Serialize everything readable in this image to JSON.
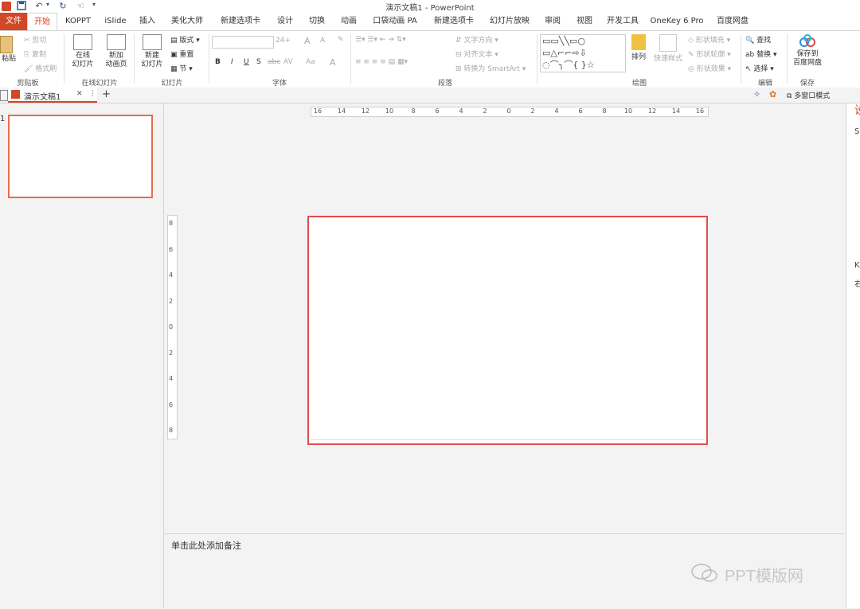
{
  "window": {
    "title": "演示文稿1 - PowerPoint"
  },
  "quick_access": {
    "undo_label": "↶",
    "redo_label": "↻",
    "dropdown": "▾"
  },
  "tabs": [
    "文件",
    "开始",
    "KOPPT",
    "iSlide",
    "插入",
    "美化大师",
    "新建选项卡",
    "设计",
    "切换",
    "动画",
    "口袋动画 PA",
    "新建选项卡",
    "幻灯片放映",
    "审阅",
    "视图",
    "开发工具",
    "OneKey 6 Pro",
    "百度网盘"
  ],
  "active_tab": "开始",
  "ribbon": {
    "clipboard": {
      "paste": "粘贴",
      "cut": "剪切",
      "copy": "复制",
      "format_painter": "格式刷",
      "label": "剪贴板"
    },
    "online_slides": {
      "online": "在线\n幻灯片",
      "new_animation": "新加\n动画页",
      "label": "在线幻灯片"
    },
    "slides": {
      "new_slide": "新建\n幻灯片",
      "layout": "版式",
      "reset": "重置",
      "section": "节",
      "label": "幻灯片"
    },
    "font": {
      "size": "24+",
      "bold": "B",
      "italic": "I",
      "underline": "U",
      "shadow": "S",
      "strike": "abc",
      "spacing": "AV",
      "case": "Aa",
      "grow": "A",
      "shrink": "A",
      "label": "字体"
    },
    "paragraph": {
      "text_direction": "文字方向",
      "align_text": "对齐文本",
      "smartart": "转换为 SmartArt",
      "label": "段落"
    },
    "drawing": {
      "arrange": "排列",
      "quick_styles": "快速样式",
      "shape_fill": "形状填充",
      "shape_outline": "形状轮廓",
      "shape_effects": "形状效果",
      "label": "绘图"
    },
    "editing": {
      "find": "查找",
      "replace": "替换",
      "select": "选择",
      "label": "编辑"
    },
    "save": {
      "save_to": "保存到\n百度网盘",
      "label": "保存"
    }
  },
  "doc_tab": {
    "name": "演示文稿1",
    "close": "✕",
    "more": "⋮",
    "add": "+",
    "multi_window": "多窗口模式"
  },
  "thumbnail": {
    "index": "1"
  },
  "ruler": {
    "h_ticks": [
      "16",
      "14",
      "12",
      "10",
      "8",
      "6",
      "4",
      "2",
      "0",
      "2",
      "4",
      "6",
      "8",
      "10",
      "12",
      "14",
      "16"
    ],
    "v_ticks": [
      "8",
      "6",
      "4",
      "2",
      "0",
      "2",
      "4",
      "6",
      "8"
    ]
  },
  "notes": {
    "placeholder": "单击此处添加备注"
  },
  "watermark": {
    "text": "PPT模版网"
  },
  "right_pane": {
    "letters": [
      "设",
      "S",
      "K",
      "右"
    ]
  },
  "colors": {
    "accent": "#d24726",
    "slide_border": "#e44b4b"
  }
}
